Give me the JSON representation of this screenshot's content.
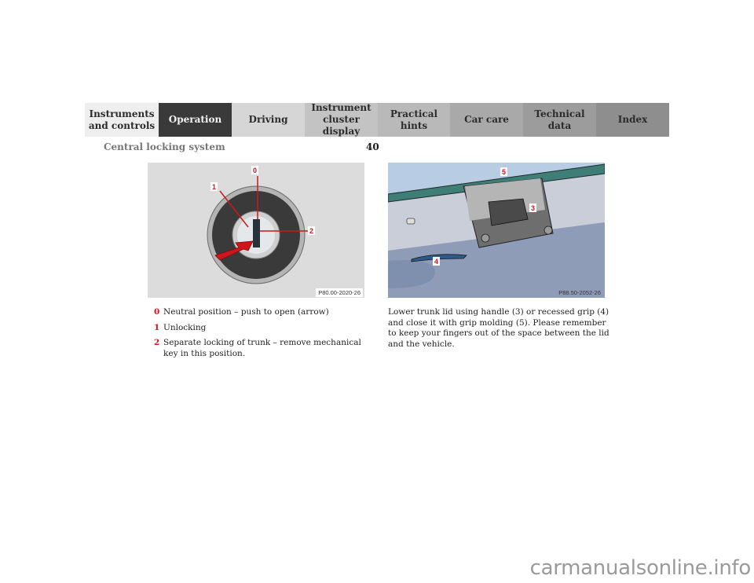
{
  "nav": {
    "tabs": [
      {
        "label": "Instruments\nand controls",
        "active": false
      },
      {
        "label": "Operation",
        "active": true
      },
      {
        "label": "Driving",
        "active": false
      },
      {
        "label": "Instrument\ncluster display",
        "active": false
      },
      {
        "label": "Practical hints",
        "active": false
      },
      {
        "label": "Car care",
        "active": false
      },
      {
        "label": "Technical\ndata",
        "active": false
      },
      {
        "label": "Index",
        "active": false
      }
    ]
  },
  "header": {
    "section_title": "Central locking system",
    "page_number": "40"
  },
  "figure1": {
    "code": "P80.00-2020-26",
    "callouts": [
      "0",
      "1",
      "2"
    ]
  },
  "figure2": {
    "code": "P88.50-2052-26",
    "callouts": [
      "5",
      "3",
      "4"
    ]
  },
  "legend": [
    {
      "num": "0",
      "text": "Neutral position – push to open (arrow)"
    },
    {
      "num": "1",
      "text": "Unlocking"
    },
    {
      "num": "2",
      "text": "Separate locking of trunk – remove mechanical key in this position."
    }
  ],
  "paragraph": "Lower trunk lid using handle (3) or recessed grip (4) and close it with grip molding (5). Please remember to keep your fingers out of the space between the lid and the vehicle.",
  "watermark": "carmanualsonline.info",
  "colors": {
    "accent_red": "#d0161c",
    "active_tab": "#3a3a3a"
  }
}
